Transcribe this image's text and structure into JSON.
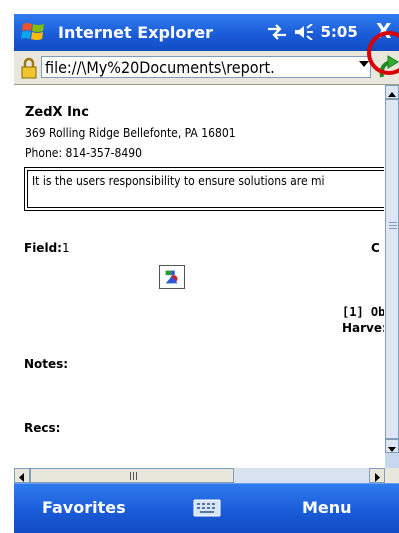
{
  "titlebar": {
    "title": "Internet Explorer",
    "time": "5:05",
    "close_label": "X"
  },
  "address_bar": {
    "url": "file://\\My%20Documents\\report."
  },
  "document": {
    "company": "ZedX Inc",
    "address": "369 Rolling Ridge Bellefonte, PA 16801",
    "phone": "Phone: 814-357-8490",
    "disclaimer": "It is the users responsibility to ensure solutions are mi",
    "field_label": "Field:",
    "field_value": "1",
    "right_col_letter": "C",
    "obs_label": "[1] Ob",
    "harvest_label": "Harve:",
    "notes_label": "Notes:",
    "recs_label": "Recs:"
  },
  "menubar": {
    "left_label": "Favorites",
    "right_label": "Menu"
  },
  "colors": {
    "titlebar_blue": "#1a5ad6",
    "highlight_ring": "#d80000"
  }
}
